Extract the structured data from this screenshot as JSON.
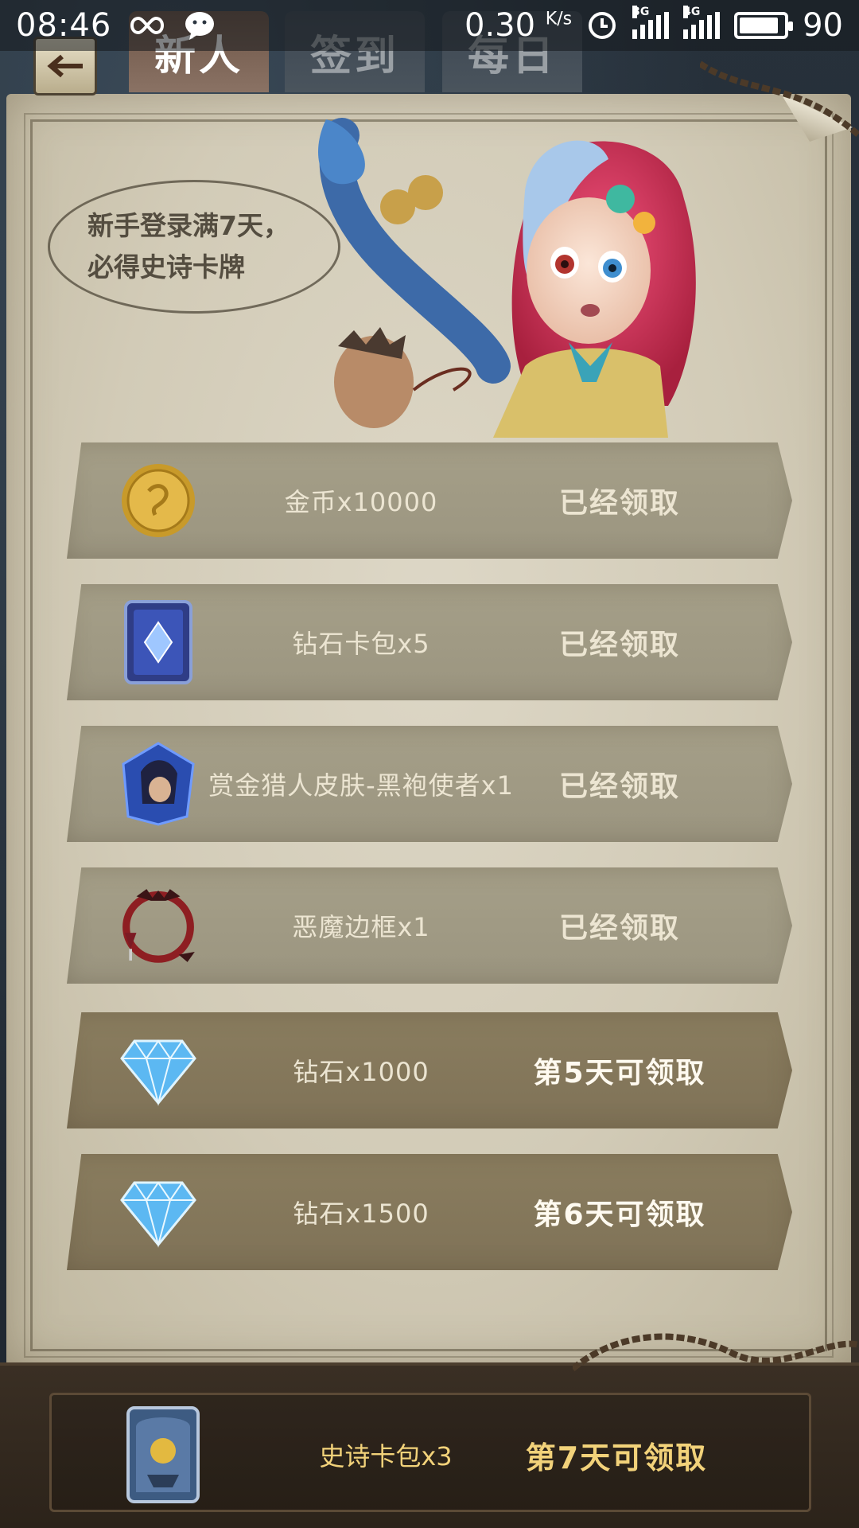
{
  "status_bar": {
    "time": "08:46",
    "speed": "0.30",
    "speed_unit": "K/s",
    "net1": "3G",
    "net2": "4G",
    "battery": "90",
    "battery_level": 0.9
  },
  "tabs": [
    {
      "label": "新人",
      "active": true
    },
    {
      "label": "签到",
      "active": false
    },
    {
      "label": "每日",
      "active": false
    }
  ],
  "banner": {
    "line1": "新手登录满7天，",
    "line2": "必得史诗卡牌"
  },
  "rewards": [
    {
      "icon": "gold-coin-icon",
      "name": "金币x10000",
      "status": "已经领取",
      "claimed": true
    },
    {
      "icon": "diamond-card-pack-icon",
      "name": "钻石卡包x5",
      "status": "已经领取",
      "claimed": true
    },
    {
      "icon": "hunter-skin-icon",
      "name": "赏金猎人皮肤-黑袍使者x1",
      "status": "已经领取",
      "claimed": true
    },
    {
      "icon": "demon-frame-icon",
      "name": "恶魔边框x1",
      "status": "已经领取",
      "claimed": true
    },
    {
      "icon": "diamond-icon",
      "name": "钻石x1000",
      "status": "第5天可领取",
      "claimed": false
    },
    {
      "icon": "diamond-icon",
      "name": "钻石x1500",
      "status": "第6天可领取",
      "claimed": false
    }
  ],
  "final_reward": {
    "icon": "epic-card-pack-icon",
    "name": "史诗卡包x3",
    "status": "第7天可领取"
  }
}
